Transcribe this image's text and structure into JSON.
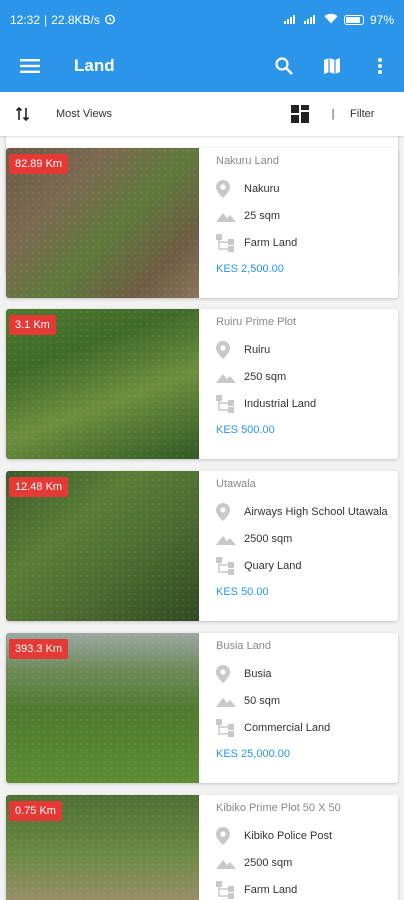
{
  "status_bar": {
    "time": "12:32",
    "speed": "22.8KB/s",
    "battery": "97"
  },
  "app_bar": {
    "title": "Land"
  },
  "sort_bar": {
    "sort_label": "Most Views",
    "separator": "|",
    "filter_label": "Filter"
  },
  "listings": [
    {
      "distance": "82.89 Km",
      "name": "Nakuru Land",
      "location": "Nakuru",
      "size": "25 sqm",
      "type": "Farm Land",
      "price": "KES 2,500.00"
    },
    {
      "distance": "3.1 Km",
      "name": "Ruiru Prime Plot",
      "location": "Ruiru",
      "size": "250 sqm",
      "type": "Industrial Land",
      "price": "KES 500.00"
    },
    {
      "distance": "12.48 Km",
      "name": "Utawala",
      "location": "Airways High School Utawala",
      "size": "2500 sqm",
      "type": "Quary Land",
      "price": "KES 50.00"
    },
    {
      "distance": "393.3 Km",
      "name": "Busia Land",
      "location": "Busia",
      "size": "50 sqm",
      "type": "Commercial Land",
      "price": "KES 25,000.00"
    },
    {
      "distance": "0.75 Km",
      "name": "Kibiko Prime Plot 50 X 50",
      "location": "Kibiko Police Post",
      "size": "2500 sqm",
      "type": "Farm Land",
      "price": ""
    }
  ],
  "colors": {
    "primary": "#2b95ea",
    "distance_badge": "#e53935",
    "price": "#2b95ea"
  },
  "icons": [
    "menu-icon",
    "search-icon",
    "map-icon",
    "more-vert-icon",
    "sort-icon",
    "grid-view-icon",
    "location-pin-icon",
    "area-icon",
    "land-type-icon"
  ]
}
